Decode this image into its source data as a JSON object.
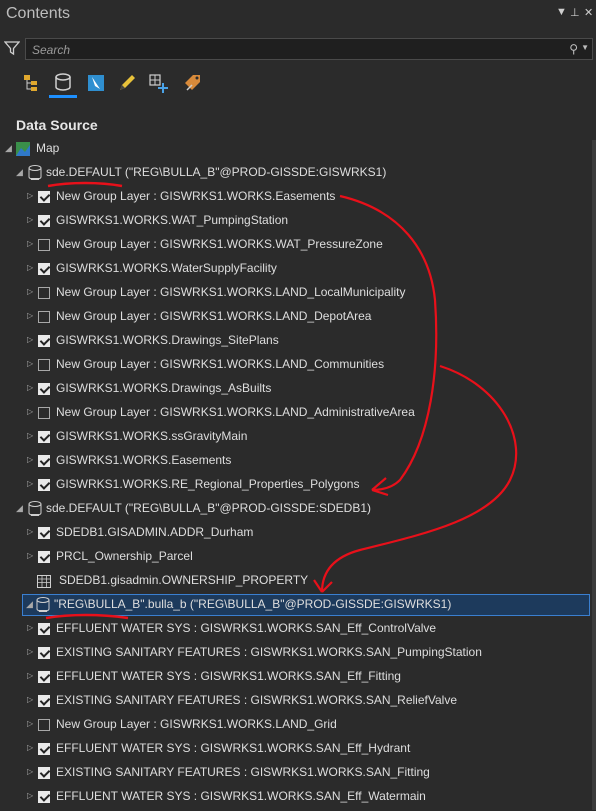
{
  "window": {
    "title": "Contents"
  },
  "search": {
    "placeholder": "Search"
  },
  "section": {
    "title": "Data Source"
  },
  "tree": {
    "map_label": "Map",
    "sources": [
      {
        "label": "sde.DEFAULT (\"REG\\BULLA_B\"@PROD-GISSDE:GISWRKS1)",
        "layers": [
          {
            "label": "New Group Layer : GISWRKS1.WORKS.Easements",
            "checked": true
          },
          {
            "label": "GISWRKS1.WORKS.WAT_PumpingStation",
            "checked": true
          },
          {
            "label": "New Group Layer : GISWRKS1.WORKS.WAT_PressureZone",
            "checked": false
          },
          {
            "label": "GISWRKS1.WORKS.WaterSupplyFacility",
            "checked": true
          },
          {
            "label": "New Group Layer : GISWRKS1.WORKS.LAND_LocalMunicipality",
            "checked": false
          },
          {
            "label": "New Group Layer : GISWRKS1.WORKS.LAND_DepotArea",
            "checked": false
          },
          {
            "label": "GISWRKS1.WORKS.Drawings_SitePlans",
            "checked": true
          },
          {
            "label": "New Group Layer : GISWRKS1.WORKS.LAND_Communities",
            "checked": false
          },
          {
            "label": "GISWRKS1.WORKS.Drawings_AsBuilts",
            "checked": true
          },
          {
            "label": "New Group Layer : GISWRKS1.WORKS.LAND_AdministrativeArea",
            "checked": false
          },
          {
            "label": "GISWRKS1.WORKS.ssGravityMain",
            "checked": true
          },
          {
            "label": "GISWRKS1.WORKS.Easements",
            "checked": true
          },
          {
            "label": "GISWRKS1.WORKS.RE_Regional_Properties_Polygons",
            "checked": true
          }
        ]
      },
      {
        "label": "sde.DEFAULT (\"REG\\BULLA_B\"@PROD-GISSDE:SDEDB1)",
        "layers": [
          {
            "label": "SDEDB1.GISADMIN.ADDR_Durham",
            "checked": true
          },
          {
            "label": "PRCL_Ownership_Parcel",
            "checked": true
          },
          {
            "label": "SDEDB1.gisadmin.OWNERSHIP_PROPERTY",
            "table": true
          }
        ]
      },
      {
        "label": "\"REG\\BULLA_B\".bulla_b (\"REG\\BULLA_B\"@PROD-GISSDE:GISWRKS1)",
        "selected": true,
        "layers": [
          {
            "label": "EFFLUENT WATER SYS : GISWRKS1.WORKS.SAN_Eff_ControlValve",
            "checked": true
          },
          {
            "label": "EXISTING SANITARY FEATURES : GISWRKS1.WORKS.SAN_PumpingStation",
            "checked": true
          },
          {
            "label": "EFFLUENT WATER SYS : GISWRKS1.WORKS.SAN_Eff_Fitting",
            "checked": true
          },
          {
            "label": "EXISTING SANITARY FEATURES : GISWRKS1.WORKS.SAN_ReliefValve",
            "checked": true
          },
          {
            "label": "New Group Layer : GISWRKS1.WORKS.LAND_Grid",
            "checked": false
          },
          {
            "label": "EFFLUENT WATER SYS : GISWRKS1.WORKS.SAN_Eff_Hydrant",
            "checked": true
          },
          {
            "label": "EXISTING SANITARY FEATURES : GISWRKS1.WORKS.SAN_Fitting",
            "checked": true
          },
          {
            "label": "EFFLUENT WATER SYS : GISWRKS1.WORKS.SAN_Eff_Watermain",
            "checked": true
          }
        ]
      }
    ]
  },
  "colors": {
    "annotation": "#e8101a",
    "accent": "#1e90ff",
    "selection": "#1d3a5c"
  },
  "icons": [
    "filter-icon",
    "search-icon",
    "list-by-drawing-order-icon",
    "list-by-data-source-icon",
    "list-by-selection-icon",
    "list-by-editing-icon",
    "list-by-snapping-icon",
    "list-by-labeling-icon",
    "map-icon",
    "database-icon",
    "table-icon"
  ]
}
